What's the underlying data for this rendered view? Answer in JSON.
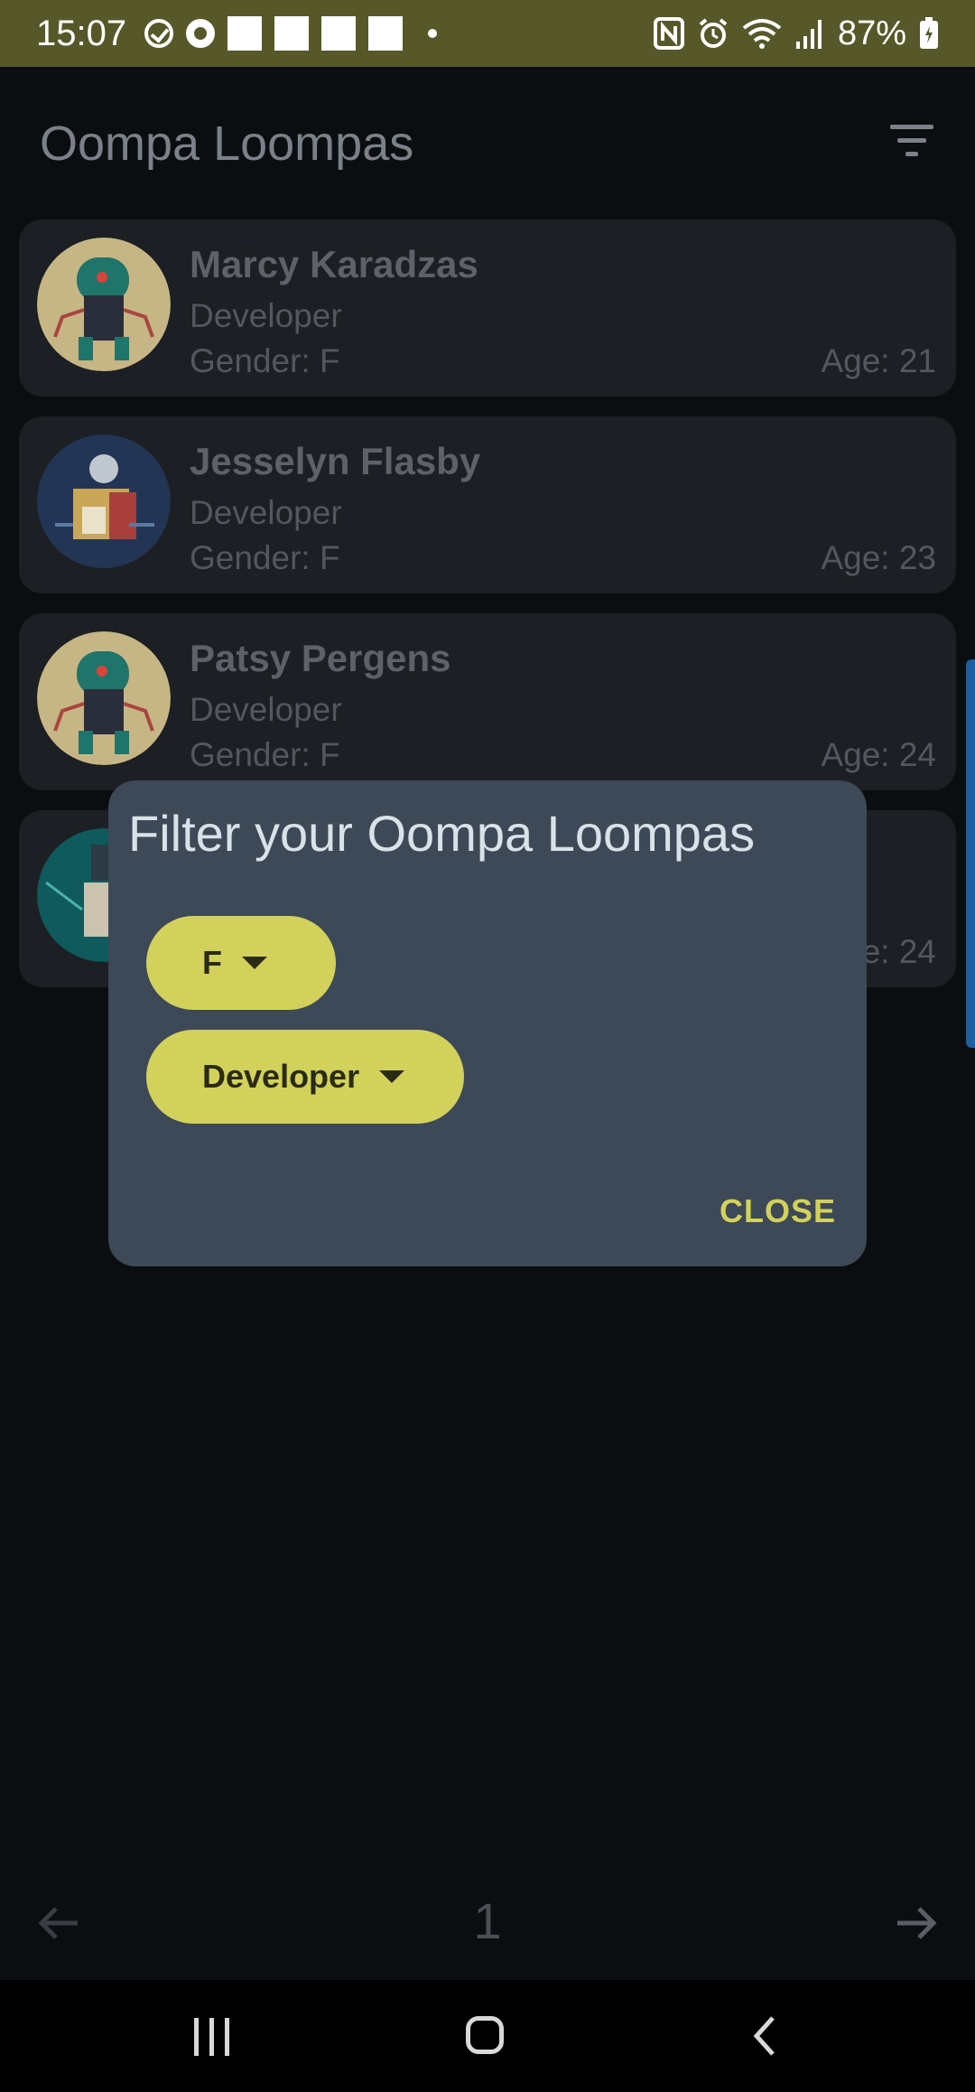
{
  "status_bar": {
    "time": "15:07",
    "battery": "87%",
    "icons": [
      "check-circle-icon",
      "ring-icon",
      "notification-square-icon",
      "nfc-icon",
      "alarm-icon",
      "wifi-icon",
      "signal-icon",
      "battery-icon"
    ]
  },
  "app_bar": {
    "title": "Oompa Loompas",
    "filter_icon": "filter-icon"
  },
  "list": {
    "items": [
      {
        "name": "Marcy Karadzas",
        "profession": "Developer",
        "gender": "Gender: F",
        "age": "Age: 21",
        "avatar": "robot-avatar-green"
      },
      {
        "name": "Jesselyn Flasby",
        "profession": "Developer",
        "gender": "Gender: F",
        "age": "Age: 23",
        "avatar": "robot-avatar-blue"
      },
      {
        "name": "Patsy Pergens",
        "profession": "Developer",
        "gender": "Gender: F",
        "age": "Age: 24",
        "avatar": "robot-avatar-green"
      },
      {
        "name": "",
        "profession": "",
        "gender": "",
        "age": "e: 24",
        "avatar": "robot-avatar-teal"
      }
    ]
  },
  "pagination": {
    "page": "1",
    "prev_icon": "arrow-left-icon",
    "next_icon": "arrow-right-icon"
  },
  "dialog": {
    "title": "Filter your Oompa Loompas",
    "gender_value": "F",
    "profession_value": "Developer",
    "close_label": "CLOSE"
  },
  "colors": {
    "status_bar": "#57582a",
    "background": "#0b0e11",
    "dialog": "#3d4956",
    "accent": "#d2d15c"
  }
}
